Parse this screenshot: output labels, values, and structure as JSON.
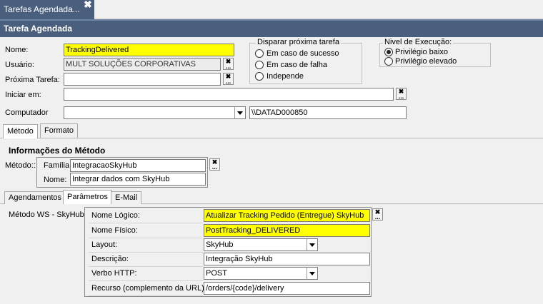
{
  "window": {
    "tab_title": "Tarefas Agendada...",
    "close_glyph": "✖",
    "panel_title": "Tarefa Agendada"
  },
  "form": {
    "nome": {
      "label": "Nome:",
      "value": "TrackingDelivered"
    },
    "usuario": {
      "label": "Usuário:",
      "value": "MULT SOLUÇÕES CORPORATIVAS"
    },
    "proxima_tarefa": {
      "label": "Próxima Tarefa:",
      "value": ""
    },
    "iniciar_em": {
      "label": "Iniciar em:",
      "value": ""
    },
    "computador": {
      "label": "Computador",
      "value": "",
      "path": "\\\\DATAD000850"
    }
  },
  "disparar": {
    "title": "Disparar próxima tarefa",
    "options": [
      "Em caso de sucesso",
      "Em caso de falha",
      "Independe"
    ],
    "selected": -1
  },
  "nivel": {
    "title": "Nivel de Execução:",
    "options": [
      "Privilégio baixo",
      "Privilégio elevado"
    ],
    "selected": 0
  },
  "tabs_top": {
    "items": [
      "Método",
      "Formato"
    ],
    "active": 0
  },
  "metodo": {
    "section_title": "Informações do Método",
    "label": "Método::",
    "familia_label": "Família:",
    "familia_value": "IntegracaoSkyHub",
    "nome_label": "Nome:",
    "nome_value": "Integrar dados com SkyHub"
  },
  "tabs_bottom": {
    "items": [
      "Agendamentos",
      "Parâmetros",
      "E-Mail"
    ],
    "active": 1
  },
  "parametros": {
    "group_label": "Método WS - SkyHub",
    "rows": [
      {
        "label": "Nome Lógico:",
        "value": "Atualizar Tracking Pedido (Entregue) SkyHub",
        "highlight": true
      },
      {
        "label": "Nome Físico:",
        "value": "PostTracking_DELIVERED",
        "highlight": true
      },
      {
        "label": "Layout:",
        "value": "SkyHub",
        "combo": true
      },
      {
        "label": "Descrição:",
        "value": "Integração SkyHub"
      },
      {
        "label": "Verbo HTTP:",
        "value": "POST",
        "combo": true
      },
      {
        "label": "Recurso (complemento da URL):",
        "value": "/orders/{code}/delivery"
      }
    ]
  },
  "picker": {
    "clear_glyph": "✖",
    "more_glyph": "..."
  }
}
